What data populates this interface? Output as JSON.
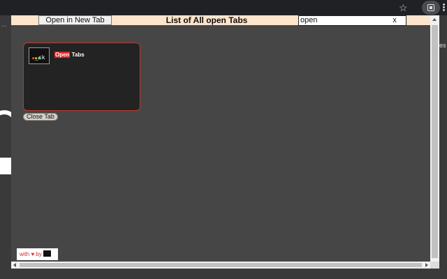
{
  "browser": {
    "star_icon": "star-icon",
    "extension_icon": "extension-icon",
    "menu_icon": "kebab-menu-icon"
  },
  "background_page": {
    "left_text": "...",
    "right_text": "es"
  },
  "popup": {
    "header": {
      "open_new_tab_label": "Open in New Tab",
      "title": "List of All open Tabs",
      "search": {
        "value": "open",
        "clear_label": "x"
      },
      "background_color": "#fde4cc"
    },
    "tabs": [
      {
        "icon_text": "_sk",
        "title_highlight": "Open",
        "title_rest": " Tabs",
        "close_label": "Close Tab",
        "border_color": "#c0392b",
        "highlight_color": "#e02020"
      }
    ],
    "footer": {
      "prefix": "with",
      "heart": "♥",
      "suffix": "by"
    }
  }
}
